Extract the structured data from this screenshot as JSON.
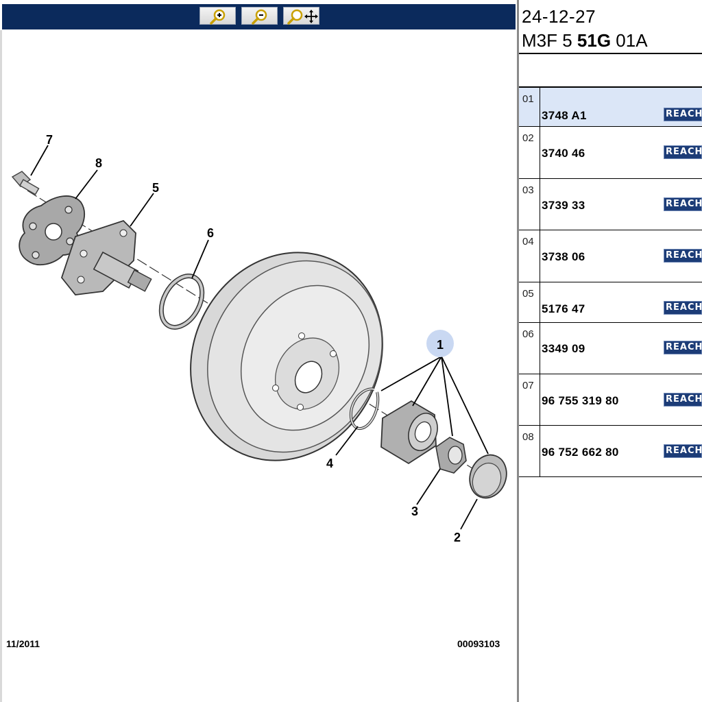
{
  "toolbar": {
    "buttons": [
      {
        "name": "zoom-in-button",
        "icon": "zoom-in-icon"
      },
      {
        "name": "zoom-out-button",
        "icon": "zoom-out-icon"
      },
      {
        "name": "zoom-pan-button",
        "icon": "zoom-pan-icon"
      }
    ]
  },
  "diagram": {
    "callouts": [
      "7",
      "8",
      "5",
      "6",
      "1",
      "4",
      "3",
      "2"
    ],
    "footer_date": "11/2011",
    "footer_code": "00093103"
  },
  "header": {
    "date": "24-12-27",
    "code_prefix": "M3F 5 ",
    "code_bold": "51G",
    "code_suffix": " 01A"
  },
  "parts": [
    {
      "num": "01",
      "ref": "3748 A1",
      "badge": "REACH",
      "selected": true
    },
    {
      "num": "02",
      "ref": "3740 46",
      "badge": "REACH",
      "selected": false
    },
    {
      "num": "03",
      "ref": "3739 33",
      "badge": "REACH",
      "selected": false
    },
    {
      "num": "04",
      "ref": "3738 06",
      "badge": "REACH",
      "selected": false
    },
    {
      "num": "05",
      "ref": "5176 47",
      "badge": "REACH",
      "selected": false
    },
    {
      "num": "06",
      "ref": "3349 09",
      "badge": "REACH",
      "selected": false
    },
    {
      "num": "07",
      "ref": "96 755 319 80",
      "badge": "REACH",
      "selected": false
    },
    {
      "num": "08",
      "ref": "96 752 662 80",
      "badge": "REACH",
      "selected": false
    }
  ],
  "colors": {
    "toolbar": "#0b2a5c",
    "badge": "#1c3c77",
    "selected_row": "#dbe6f7",
    "callout_highlight": "#c9d8f2"
  }
}
